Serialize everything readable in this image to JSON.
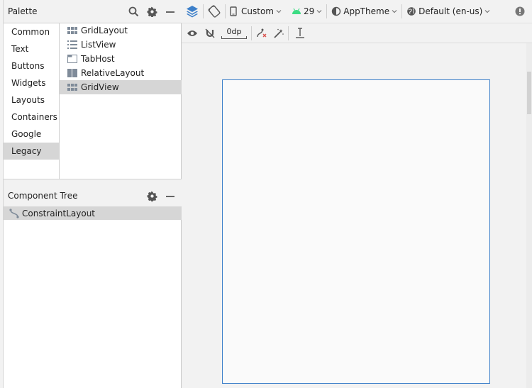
{
  "palette": {
    "title": "Palette",
    "categories": [
      "Common",
      "Text",
      "Buttons",
      "Widgets",
      "Layouts",
      "Containers",
      "Google",
      "Legacy"
    ],
    "selected_category": "Legacy",
    "items": [
      {
        "label": "GridLayout",
        "icon": "grid-layout-icon"
      },
      {
        "label": "ListView",
        "icon": "list-view-icon"
      },
      {
        "label": "TabHost",
        "icon": "tab-host-icon"
      },
      {
        "label": "RelativeLayout",
        "icon": "relative-layout-icon"
      },
      {
        "label": "GridView",
        "icon": "grid-view-icon"
      }
    ],
    "selected_item": "GridView"
  },
  "component_tree": {
    "title": "Component Tree",
    "root": {
      "label": "ConstraintLayout",
      "icon": "constraint-layout-icon"
    }
  },
  "toolbar": {
    "device": "Custom",
    "api_level": "29",
    "theme": "AppTheme",
    "locale": "Default (en-us)",
    "default_margin": "0dp"
  },
  "colors": {
    "accent_blue": "#3c7fc9",
    "android_green": "#3ddc84",
    "selection_gray": "#d6d6d6"
  }
}
